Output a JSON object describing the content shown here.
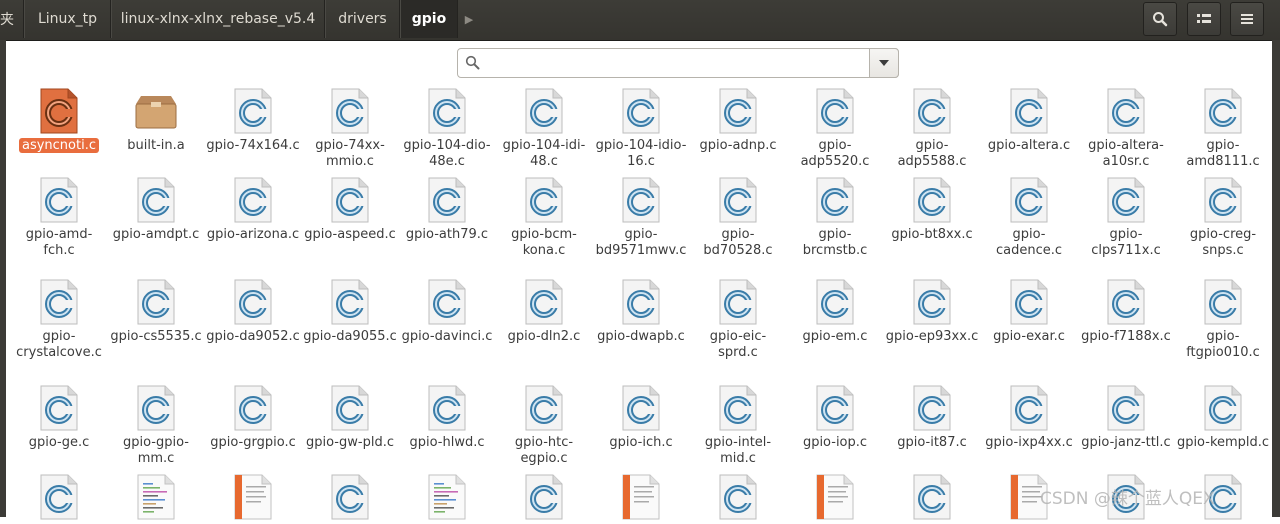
{
  "breadcrumbs": [
    "夹",
    "Linux_tp",
    "linux-xlnx-xlnx_rebase_v5.4",
    "drivers",
    "gpio"
  ],
  "search": {
    "placeholder": "",
    "value": ""
  },
  "toolbar": {
    "search_icon": "search-icon",
    "view_icon": "view-toggle-icon",
    "menu_icon": "menu-icon"
  },
  "files": [
    {
      "name": "asyncnoti.c",
      "type": "c-selected"
    },
    {
      "name": "built-in.a",
      "type": "archive"
    },
    {
      "name": "gpio-74x164.c",
      "type": "c"
    },
    {
      "name": "gpio-74xx-mmio.c",
      "type": "c"
    },
    {
      "name": "gpio-104-dio-48e.c",
      "type": "c"
    },
    {
      "name": "gpio-104-idi-48.c",
      "type": "c"
    },
    {
      "name": "gpio-104-idio-16.c",
      "type": "c"
    },
    {
      "name": "gpio-adnp.c",
      "type": "c"
    },
    {
      "name": "gpio-adp5520.c",
      "type": "c"
    },
    {
      "name": "gpio-adp5588.c",
      "type": "c"
    },
    {
      "name": "gpio-altera.c",
      "type": "c"
    },
    {
      "name": "gpio-altera-a10sr.c",
      "type": "c"
    },
    {
      "name": "gpio-amd8111.c",
      "type": "c"
    },
    {
      "name": "gpio-amd-fch.c",
      "type": "c"
    },
    {
      "name": "gpio-amdpt.c",
      "type": "c"
    },
    {
      "name": "gpio-arizona.c",
      "type": "c"
    },
    {
      "name": "gpio-aspeed.c",
      "type": "c"
    },
    {
      "name": "gpio-ath79.c",
      "type": "c"
    },
    {
      "name": "gpio-bcm-kona.c",
      "type": "c"
    },
    {
      "name": "gpio-bd9571mwv.c",
      "type": "c"
    },
    {
      "name": "gpio-bd70528.c",
      "type": "c"
    },
    {
      "name": "gpio-brcmstb.c",
      "type": "c"
    },
    {
      "name": "gpio-bt8xx.c",
      "type": "c"
    },
    {
      "name": "gpio-cadence.c",
      "type": "c"
    },
    {
      "name": "gpio-clps711x.c",
      "type": "c"
    },
    {
      "name": "gpio-creg-snps.c",
      "type": "c"
    },
    {
      "name": "gpio-crystalcove.c",
      "type": "c"
    },
    {
      "name": "gpio-cs5535.c",
      "type": "c"
    },
    {
      "name": "gpio-da9052.c",
      "type": "c"
    },
    {
      "name": "gpio-da9055.c",
      "type": "c"
    },
    {
      "name": "gpio-davinci.c",
      "type": "c"
    },
    {
      "name": "gpio-dln2.c",
      "type": "c"
    },
    {
      "name": "gpio-dwapb.c",
      "type": "c"
    },
    {
      "name": "gpio-eic-sprd.c",
      "type": "c"
    },
    {
      "name": "gpio-em.c",
      "type": "c"
    },
    {
      "name": "gpio-ep93xx.c",
      "type": "c"
    },
    {
      "name": "gpio-exar.c",
      "type": "c"
    },
    {
      "name": "gpio-f7188x.c",
      "type": "c"
    },
    {
      "name": "gpio-ftgpio010.c",
      "type": "c"
    },
    {
      "name": "gpio-ge.c",
      "type": "c"
    },
    {
      "name": "gpio-gpio-mm.c",
      "type": "c"
    },
    {
      "name": "gpio-grgpio.c",
      "type": "c"
    },
    {
      "name": "gpio-gw-pld.c",
      "type": "c"
    },
    {
      "name": "gpio-hlwd.c",
      "type": "c"
    },
    {
      "name": "gpio-htc-egpio.c",
      "type": "c"
    },
    {
      "name": "gpio-ich.c",
      "type": "c"
    },
    {
      "name": "gpio-intel-mid.c",
      "type": "c"
    },
    {
      "name": "gpio-iop.c",
      "type": "c"
    },
    {
      "name": "gpio-it87.c",
      "type": "c"
    },
    {
      "name": "gpio-ixp4xx.c",
      "type": "c"
    },
    {
      "name": "gpio-janz-ttl.c",
      "type": "c"
    },
    {
      "name": "gpio-kempld.c",
      "type": "c"
    },
    {
      "name": "",
      "type": "c"
    },
    {
      "name": "",
      "type": "text"
    },
    {
      "name": "",
      "type": "doc"
    },
    {
      "name": "",
      "type": "c"
    },
    {
      "name": "",
      "type": "text"
    },
    {
      "name": "",
      "type": "c"
    },
    {
      "name": "",
      "type": "doc"
    },
    {
      "name": "",
      "type": "c"
    },
    {
      "name": "",
      "type": "doc"
    },
    {
      "name": "",
      "type": "c"
    },
    {
      "name": "",
      "type": "doc"
    },
    {
      "name": "",
      "type": "c"
    },
    {
      "name": "",
      "type": "c"
    }
  ],
  "watermark": "CSDN @辣个蓝人QEX"
}
